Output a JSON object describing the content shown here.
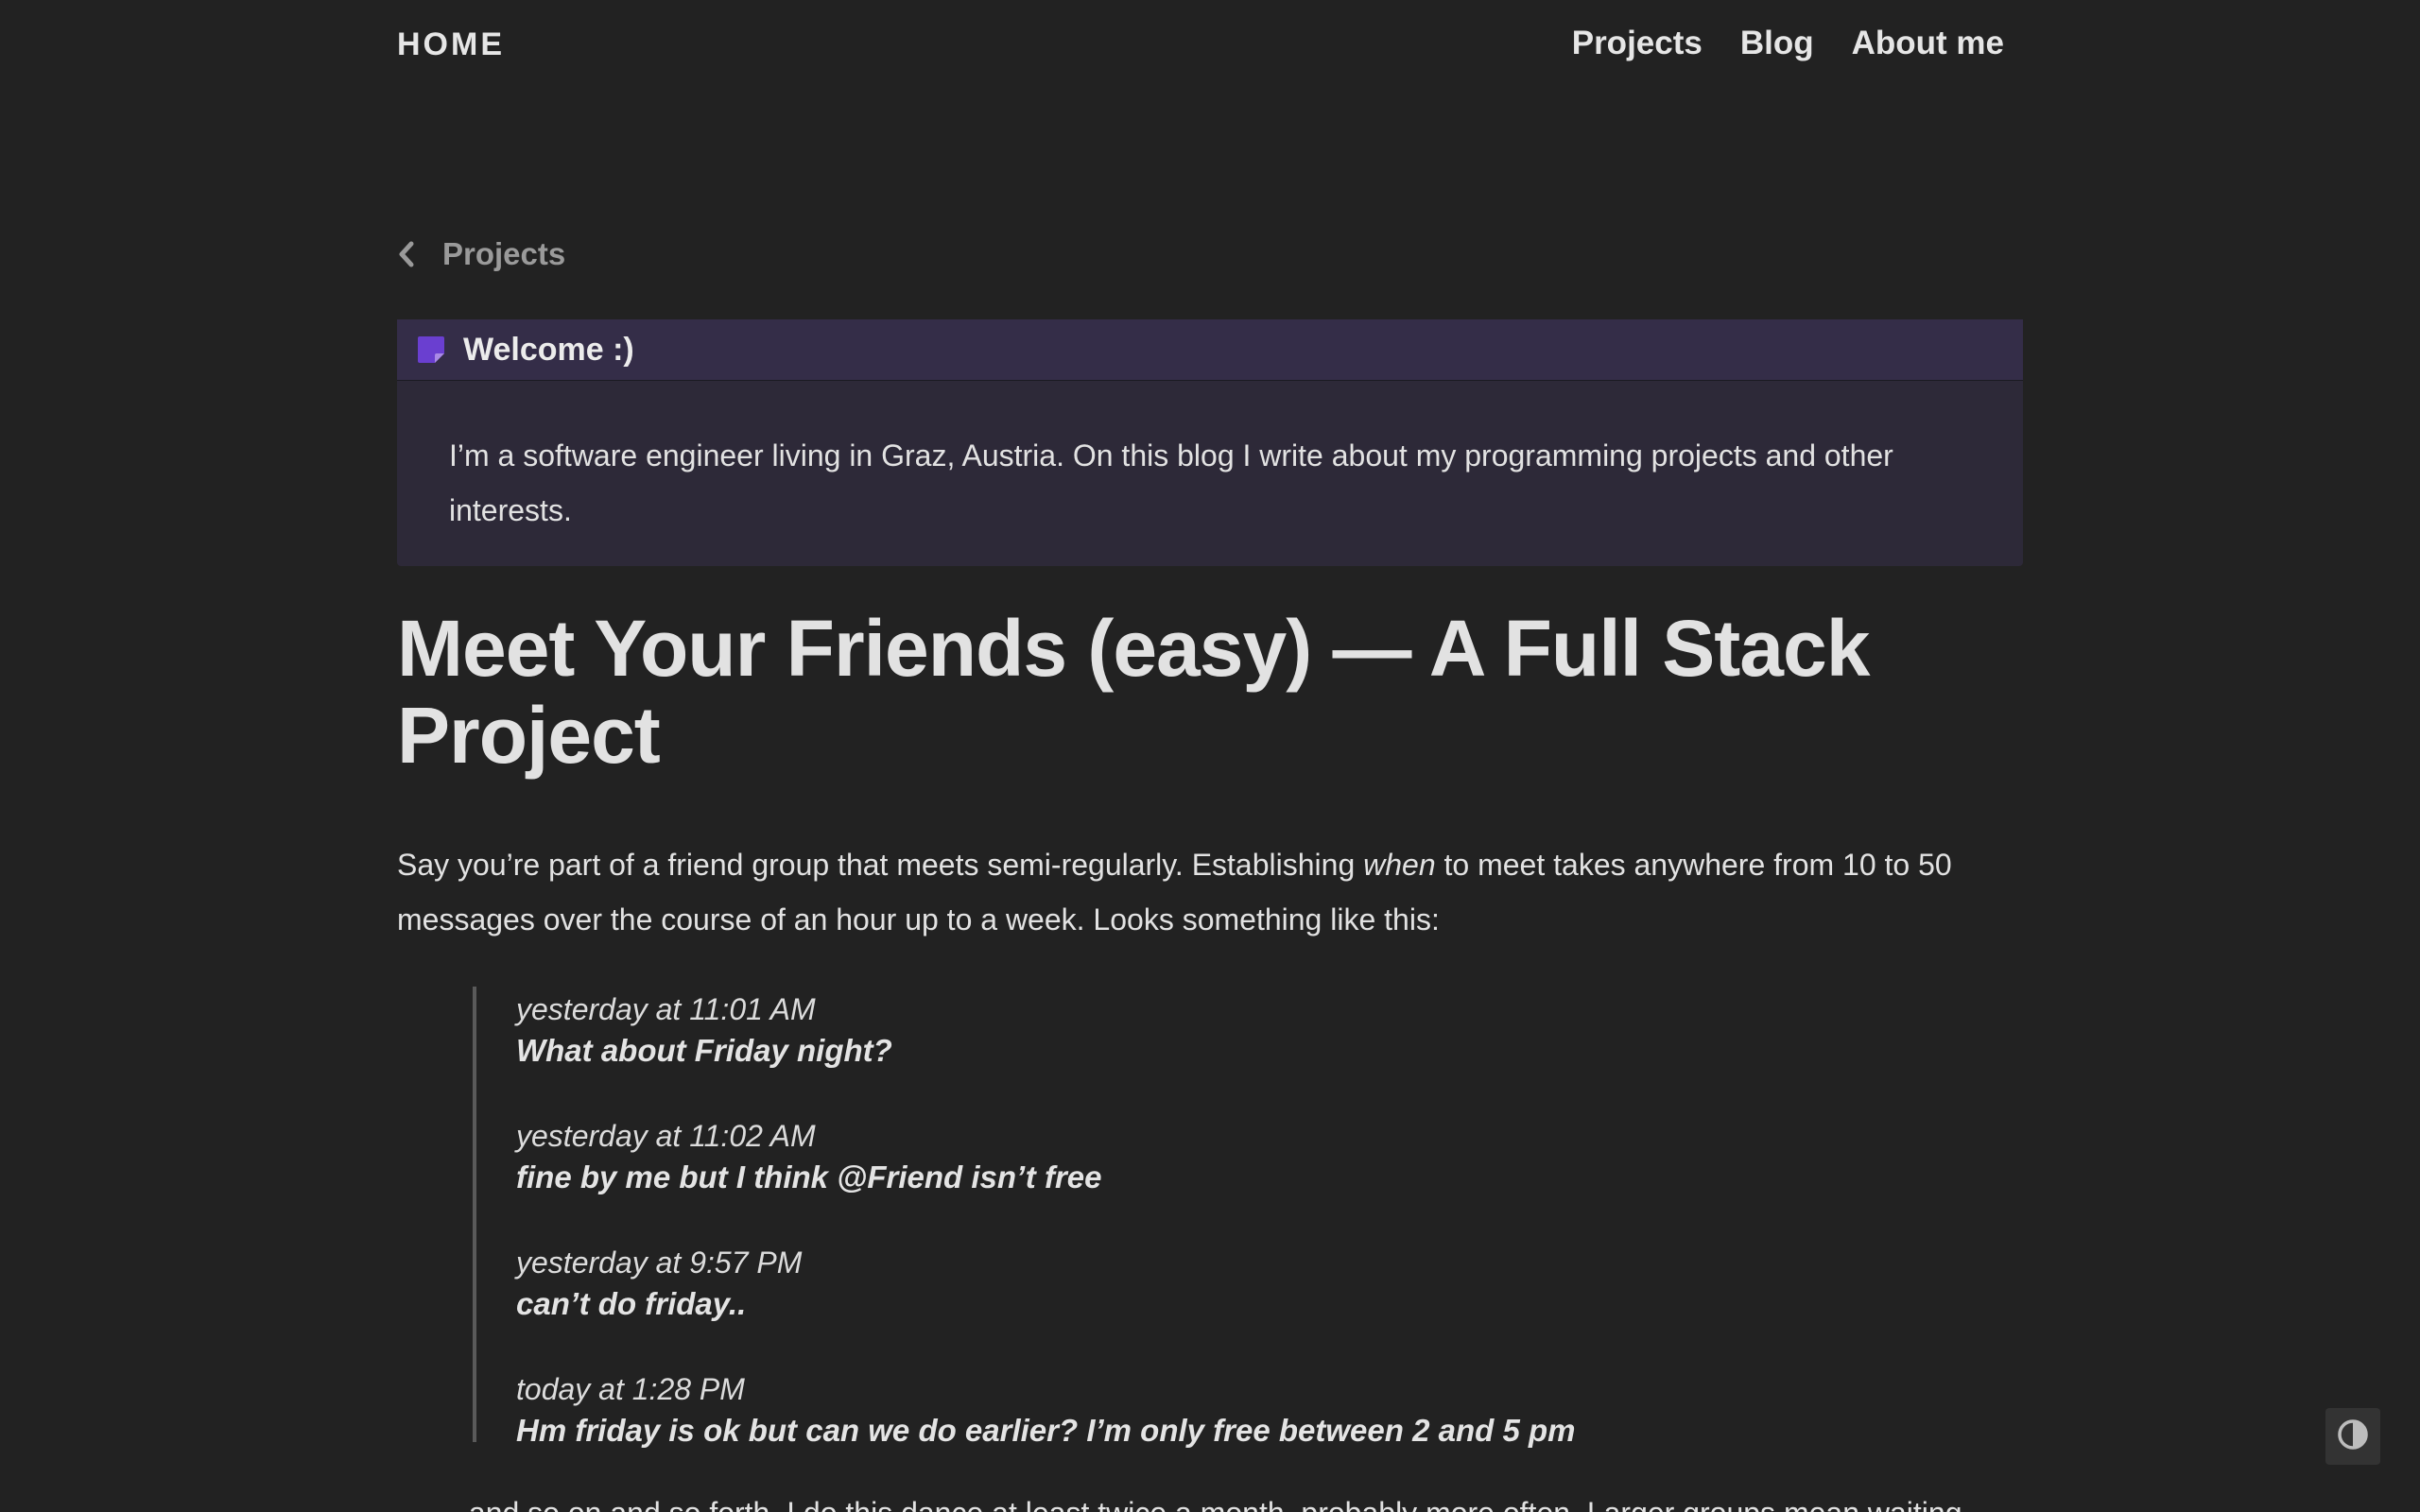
{
  "header": {
    "home_label": "HOME",
    "nav": [
      "Projects",
      "Blog",
      "About me"
    ]
  },
  "breadcrumb": {
    "icon": "chevron-left-icon",
    "label": "Projects"
  },
  "callout": {
    "icon": "note-icon",
    "title": "Welcome :)",
    "body": "I’m a software engineer living in Graz, Austria. On this blog I write about my programming projects and other interests."
  },
  "article": {
    "title": "Meet Your Friends (easy) — A Full Stack Project",
    "intro_before": "Say you’re part of a friend group that meets semi-regularly. Establishing ",
    "intro_em": "when",
    "intro_after": " to meet takes anywhere from 10 to 50 messages over the course of an hour up to a week. Looks something like this:",
    "messages": [
      {
        "time": "yesterday at 11:01 AM",
        "text": "What about Friday night?"
      },
      {
        "time": "yesterday at 11:02 AM",
        "text": "fine by me but I think @Friend isn’t free"
      },
      {
        "time": "yesterday at 9:57 PM",
        "text": "can’t do friday.."
      },
      {
        "time": "today at 1:28 PM",
        "text": "Hm friday is ok but can we do earlier? I’m only free between 2 and 5 pm"
      }
    ],
    "continuation": "… and so on and so forth. I do this dance at least twice a month, probably more often. Larger groups mean waiting"
  },
  "theme_toggle": {
    "icon": "contrast-icon"
  },
  "colors": {
    "background": "#222222",
    "callout_header": "#342d48",
    "callout_body": "#2d2938",
    "accent": "#6a3fd0",
    "text": "#e2e2e2",
    "muted": "#9a9a9a"
  }
}
